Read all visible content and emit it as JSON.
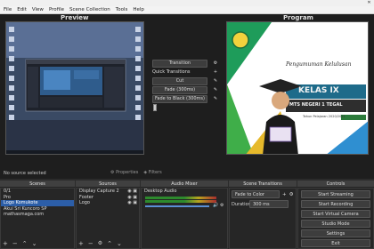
{
  "menu": [
    "File",
    "Edit",
    "View",
    "Profile",
    "Scene Collection",
    "Tools",
    "Help"
  ],
  "panes": {
    "preview": "Preview",
    "program": "Program"
  },
  "transitions": {
    "transition_button": "Transition",
    "quick_transitions": "Quick Transitions",
    "items": [
      "Cut",
      "Fade (300ms)",
      "Fade to Black (300ms)"
    ]
  },
  "program_slide": {
    "headline": "Pengumuman Kelulusan",
    "class_text": "KELAS IX",
    "school": "MTS NEGERI 1 TEGAL",
    "year": "Tahun Pelajaran 2020/2021"
  },
  "status": {
    "source_selected": "No source selected",
    "properties": "Properties",
    "filters": "Filters"
  },
  "docks": {
    "scenes": "Scenes",
    "sources": "Sources",
    "audio_mixer": "Audio Mixer",
    "scene_transitions": "Scene Transitions",
    "controls": "Controls"
  },
  "scenes": [
    "0/1",
    "Pro",
    "Logo Komukote",
    "Akui Sri Kuncoro SP",
    "mathasmaga.com"
  ],
  "selected_scene_index": 2,
  "sources": [
    "Display Capture 2",
    "Footer",
    "Logo"
  ],
  "audio": {
    "channel": "Desktop Audio"
  },
  "scene_transitions": {
    "type": "Fade to Color",
    "duration_label": "Duration",
    "duration": "300 ms"
  },
  "controls": [
    "Start Streaming",
    "Start Recording",
    "Start Virtual Camera",
    "Studio Mode",
    "Settings",
    "Exit"
  ],
  "colors": {
    "selected": "#2c5ea8",
    "dock_bg": "#262626"
  }
}
